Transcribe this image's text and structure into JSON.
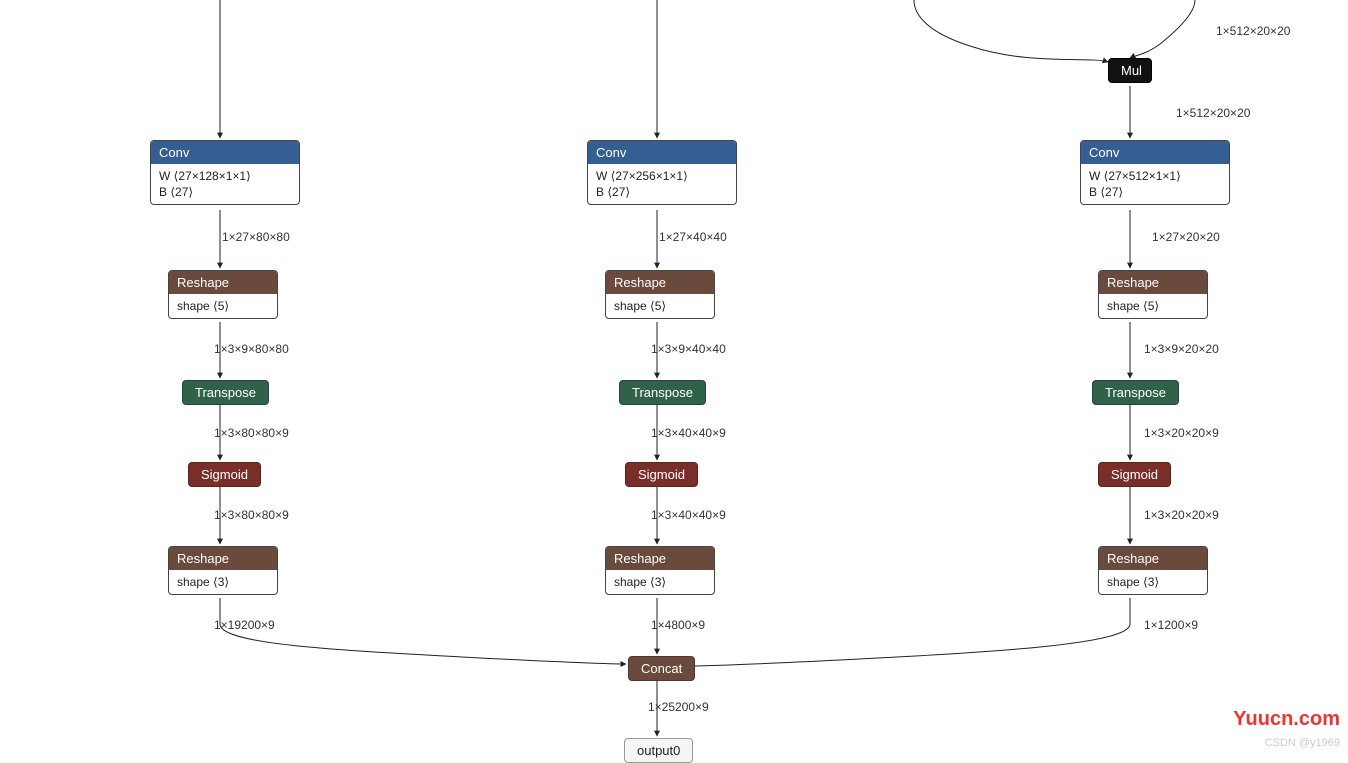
{
  "branches": [
    {
      "conv_w": "W ⟨27×128×1×1⟩",
      "conv_b": "B ⟨27⟩",
      "a_conv": "1×27×80×80",
      "a_resh1": "1×3×9×80×80",
      "a_trans": "1×3×80×80×9",
      "a_sig": "1×3×80×80×9",
      "a_resh2": "1×19200×9"
    },
    {
      "conv_w": "W ⟨27×256×1×1⟩",
      "conv_b": "B ⟨27⟩",
      "a_conv": "1×27×40×40",
      "a_resh1": "1×3×9×40×40",
      "a_trans": "1×3×40×40×9",
      "a_sig": "1×3×40×40×9",
      "a_resh2": "1×4800×9"
    },
    {
      "conv_w": "W ⟨27×512×1×1⟩",
      "conv_b": "B ⟨27⟩",
      "a_conv": "1×27×20×20",
      "a_resh1": "1×3×9×20×20",
      "a_trans": "1×3×20×20×9",
      "a_sig": "1×3×20×20×9",
      "a_resh2": "1×1200×9"
    }
  ],
  "top_right": {
    "e1": "1×512×20×20",
    "mul": "Mul",
    "e2": "1×512×20×20"
  },
  "labels": {
    "conv": "Conv",
    "reshape": "Reshape",
    "shape5": "shape ⟨5⟩",
    "shape3": "shape ⟨3⟩",
    "transpose": "Transpose",
    "sigmoid": "Sigmoid",
    "concat": "Concat",
    "after_concat": "1×25200×9",
    "output": "output0"
  },
  "watermark1": "Yuucn.com",
  "watermark2": "CSDN @y1969"
}
